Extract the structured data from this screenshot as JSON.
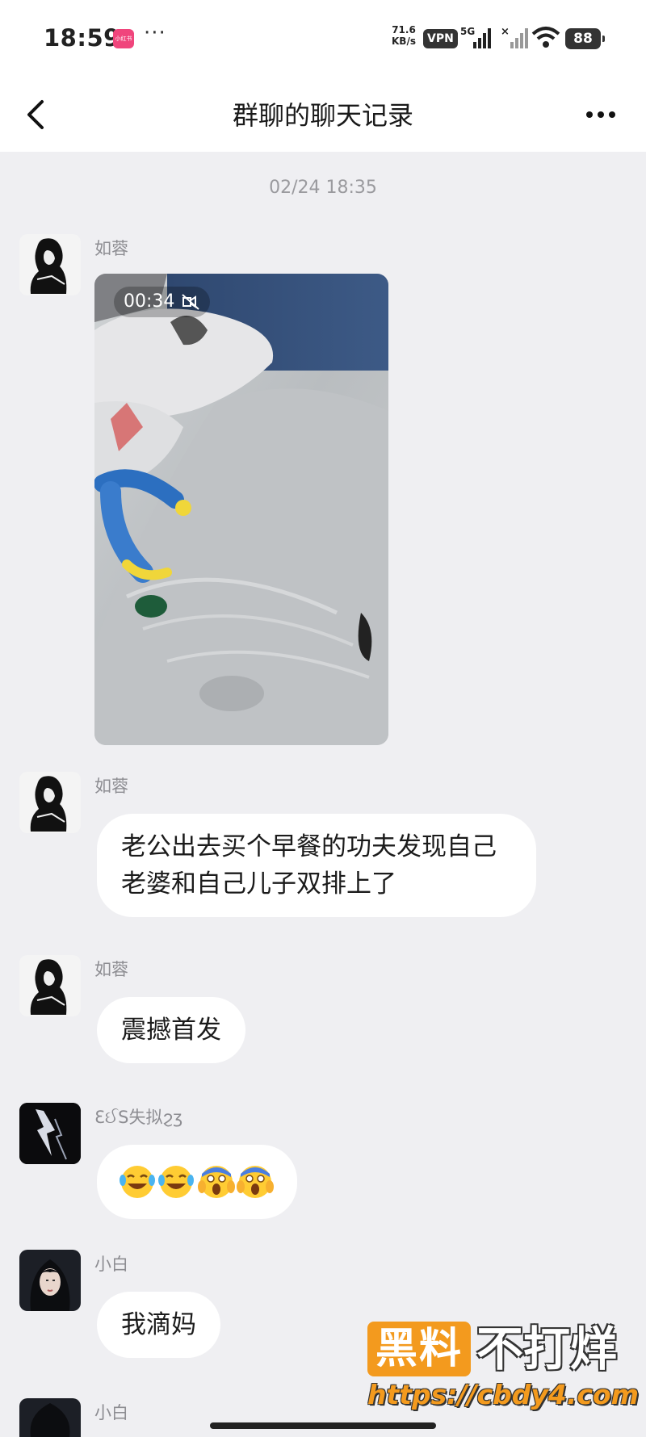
{
  "status_bar": {
    "time": "18:59",
    "app_badge": "小红书",
    "more": "···",
    "net_speed_value": "71.6",
    "net_speed_unit": "KB/s",
    "vpn": "VPN",
    "network_type": "5G",
    "battery": "88"
  },
  "nav": {
    "title": "群聊的聊天记录",
    "back_icon": "chevron-left-icon",
    "more_icon": "more-dots-icon"
  },
  "chat": {
    "timestamp": "02/24 18:35",
    "messages": [
      {
        "sender": "如蓉",
        "type": "video",
        "duration": "00:34",
        "muted": true
      },
      {
        "sender": "如蓉",
        "type": "text",
        "text": "老公出去买个早餐的功夫发现自己老婆和自己儿子双排上了"
      },
      {
        "sender": "如蓉",
        "type": "text",
        "text": "震撼首发"
      },
      {
        "sender": "ƐઈЅ失拟ϩʒ",
        "type": "emoji",
        "emojis": [
          "joy-tears",
          "joy-tears",
          "screaming-fear",
          "screaming-fear"
        ]
      },
      {
        "sender": "小白",
        "type": "text",
        "text": "我滴妈"
      },
      {
        "sender": "小白",
        "type": "partial"
      }
    ]
  },
  "watermark": {
    "box_text": "黑料",
    "text": "不打烊",
    "url": "https://cbdy4.com"
  },
  "colors": {
    "background": "#efeff2",
    "bubble": "#ffffff",
    "watermark_orange": "#f39a1e"
  }
}
